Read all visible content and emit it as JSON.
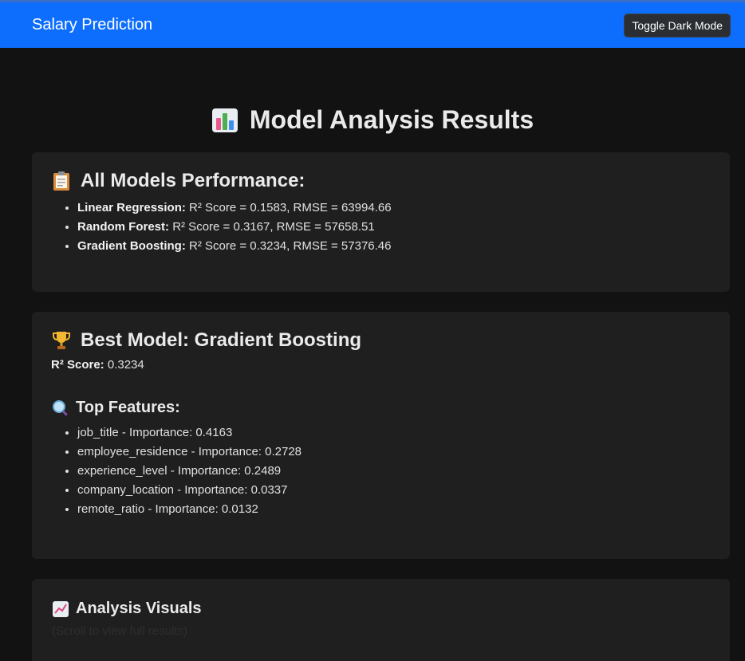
{
  "navbar": {
    "brand": "Salary Prediction",
    "toggle_label": "Toggle Dark Mode"
  },
  "page": {
    "title": "Model Analysis Results",
    "title_icon": "bar-chart-icon"
  },
  "all_models": {
    "heading": "All Models Performance:",
    "icon": "clipboard-icon",
    "models": [
      {
        "name": "Linear Regression:",
        "metrics": "R² Score = 0.1583, RMSE = 63994.66"
      },
      {
        "name": "Random Forest:",
        "metrics": "R² Score = 0.3167, RMSE = 57658.51"
      },
      {
        "name": "Gradient Boosting:",
        "metrics": "R² Score = 0.3234, RMSE = 57376.46"
      }
    ]
  },
  "best_model": {
    "heading": "Best Model: Gradient Boosting",
    "icon": "trophy-icon",
    "r2_label": "R² Score:",
    "r2_value": "0.3234",
    "features_heading": "Top Features:",
    "features_icon": "magnifier-icon",
    "features": [
      "job_title - Importance: 0.4163",
      "employee_residence - Importance: 0.2728",
      "experience_level - Importance: 0.2489",
      "company_location - Importance: 0.0337",
      "remote_ratio - Importance: 0.0132"
    ]
  },
  "visuals": {
    "heading": "Analysis Visuals",
    "icon": "trend-chart-icon",
    "hint": "(Scroll to view full results)"
  },
  "colors": {
    "navbar": "#0d6efd",
    "background": "#121212",
    "card": "#1f1f1f"
  }
}
